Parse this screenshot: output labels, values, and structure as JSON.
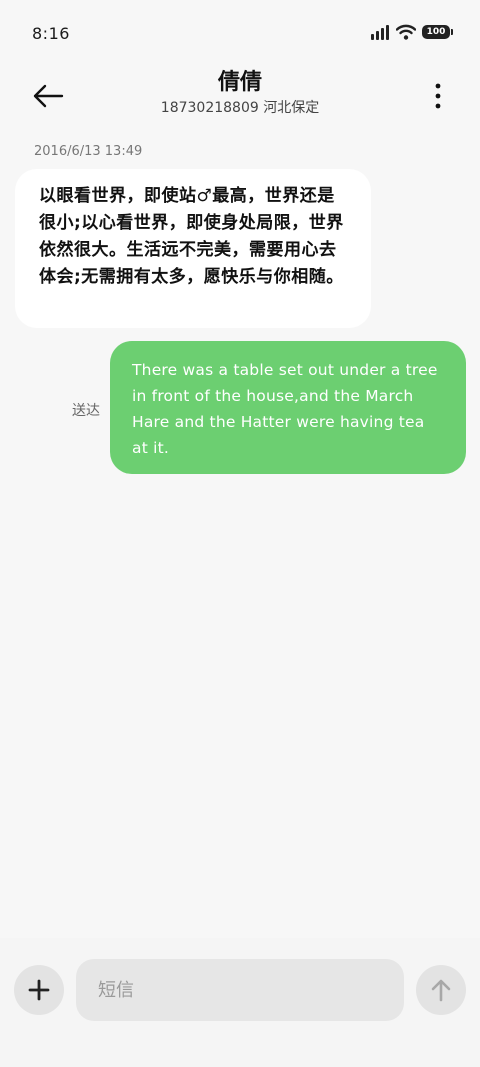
{
  "status_bar": {
    "time": "8:16",
    "battery": "100"
  },
  "header": {
    "contact_name": "倩倩",
    "contact_subtitle": "18730218809 河北保定"
  },
  "conversation": {
    "timestamp": "2016/6/13 13:49",
    "messages": [
      {
        "direction": "received",
        "text": "以眼看世界，即使站♂最高，世界还是很小;以心看世界，即使身处局限，世界依然很大。生活远不完美，需要用心去体会;无需拥有太多，愿快乐与你相随。"
      },
      {
        "direction": "sent",
        "status": "送达",
        "text": "There was a table set out under a tree in front of the house,and the March Hare and the Hatter were having tea at it."
      }
    ]
  },
  "composer": {
    "placeholder": "短信"
  },
  "colors": {
    "sent_bubble": "#6ccf71",
    "received_bubble": "#ffffff",
    "background": "#f7f7f7"
  },
  "icons": {
    "back": "arrow-left-icon",
    "more": "more-vertical-icon",
    "add": "plus-icon",
    "send": "arrow-up-icon",
    "signal": "signal-icon",
    "wifi": "wifi-icon",
    "battery": "battery-icon"
  }
}
